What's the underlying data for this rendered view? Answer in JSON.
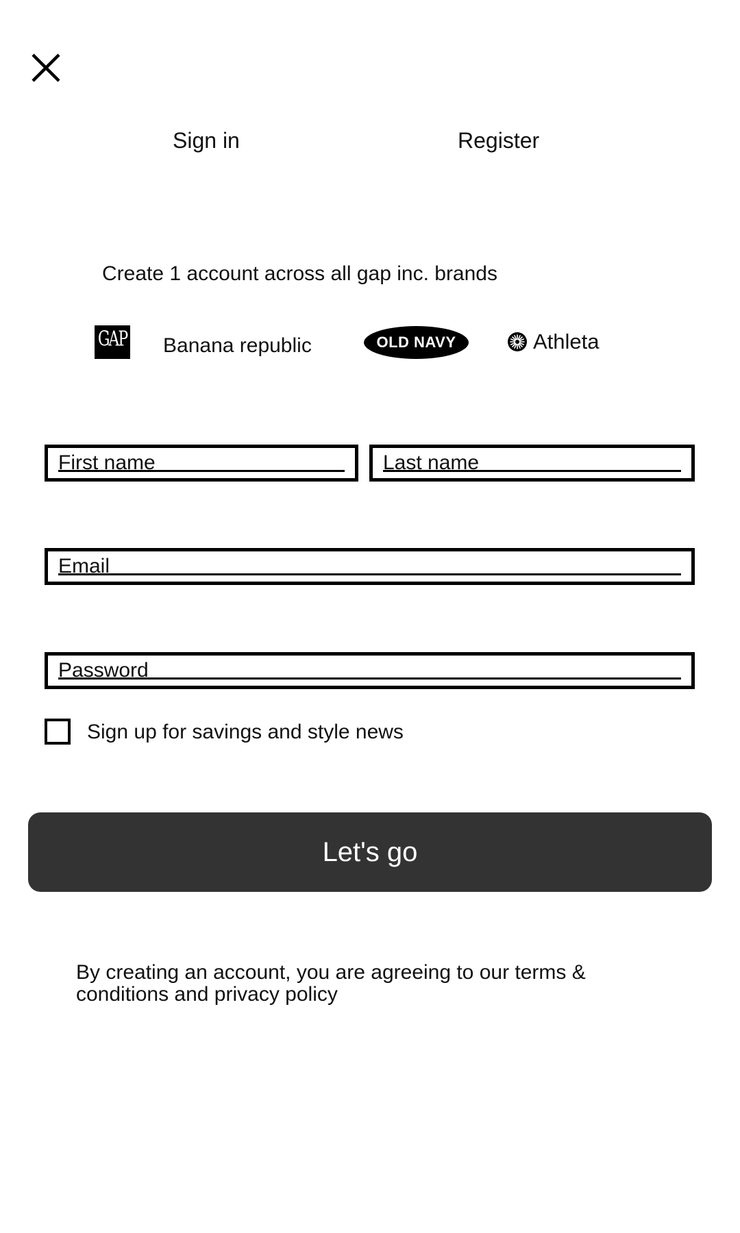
{
  "header": {
    "close_icon": "close-icon"
  },
  "tabs": [
    {
      "label": "Sign in"
    },
    {
      "label": "Register"
    }
  ],
  "tagline": "Create 1 account across all gap inc. brands",
  "brands": {
    "gap": "GAP",
    "banana_republic": "Banana republic",
    "old_navy": "OLD NAVY",
    "athleta": "Athleta",
    "athleta_icon": "athleta-logo-icon"
  },
  "form": {
    "first_name_placeholder": "First name",
    "last_name_placeholder": "Last name",
    "email_placeholder": "Email",
    "password_placeholder": "Password",
    "newsletter_label": "Sign up for savings and style news",
    "newsletter_checked": false,
    "submit_label": "Let's go"
  },
  "legal": "By creating an account, you are agreeing to our terms & conditions and privacy policy",
  "colors": {
    "button_bg": "#333333",
    "button_text": "#ffffff",
    "border": "#000000"
  }
}
